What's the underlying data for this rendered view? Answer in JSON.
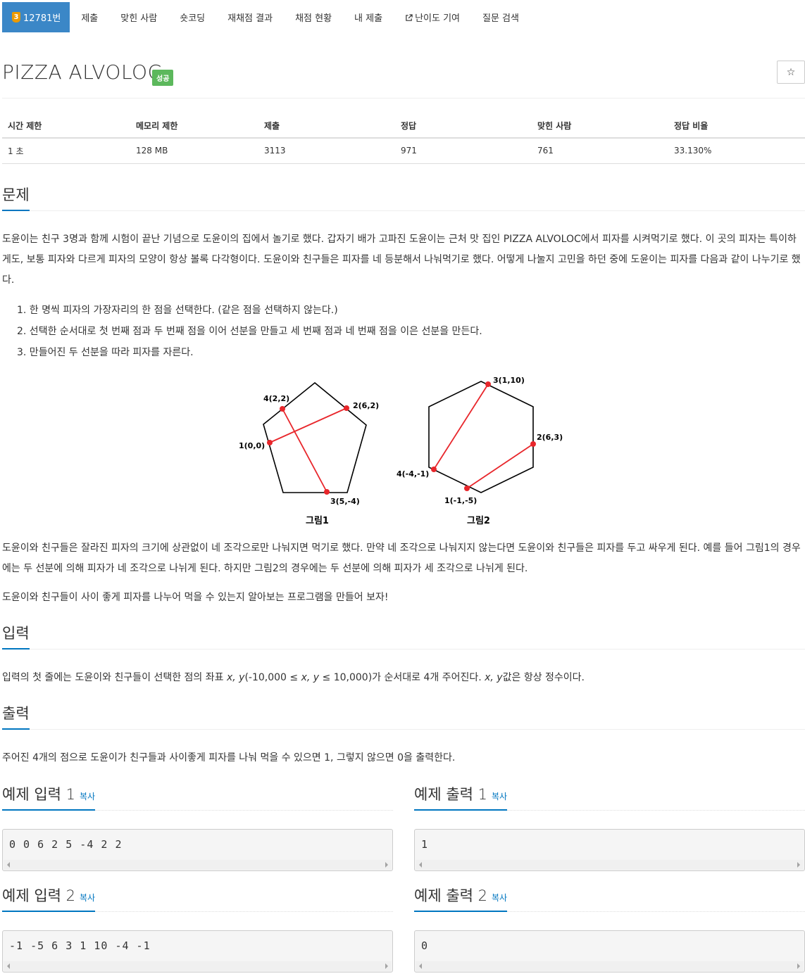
{
  "nav": {
    "problem_tier": "3",
    "problem_id": "12781번",
    "items": [
      "제출",
      "맞힌 사람",
      "숏코딩",
      "재채점 결과",
      "채점 현황",
      "내 제출",
      "난이도 기여",
      "질문 검색"
    ]
  },
  "title": "PIZZA ALVOLOC",
  "result_label": "성공",
  "star": "☆",
  "info": {
    "headers": [
      "시간 제한",
      "메모리 제한",
      "제출",
      "정답",
      "맞힌 사람",
      "정답 비율"
    ],
    "values": [
      "1 초",
      "128 MB",
      "3113",
      "971",
      "761",
      "33.130%"
    ]
  },
  "sections": {
    "problem": "문제",
    "input": "입력",
    "output": "출력"
  },
  "problem": {
    "p1": "도윤이는 친구 3명과 함께 시험이 끝난 기념으로 도윤이의 집에서 놀기로 했다. 갑자기 배가 고파진 도윤이는 근처 맛 집인 PIZZA ALVOLOC에서 피자를 시켜먹기로 했다. 이 곳의 피자는 특이하게도, 보통 피자와 다르게 피자의 모양이 항상 볼록 다각형이다. 도윤이와 친구들은 피자를 네 등분해서 나눠먹기로 했다. 어떻게 나눌지 고민을 하던 중에 도윤이는 피자를 다음과 같이 나누기로 했다.",
    "steps": [
      "1. 한 명씩 피자의 가장자리의 한 점을 선택한다. (같은 점을 선택하지 않는다.)",
      "2. 선택한 순서대로 첫 번째 점과 두 번째 점을 이어 선분을 만들고 세 번째 점과 네 번째 점을 이은 선분을 만든다.",
      "3. 만들어진 두 선분을 따라 피자를 자른다."
    ],
    "p2": "도윤이와 친구들은 잘라진 피자의 크기에 상관없이 네 조각으로만 나눠지면 먹기로 했다. 만약 네 조각으로 나눠지지 않는다면 도윤이와 친구들은 피자를 두고 싸우게 된다. 예를 들어 그림1의 경우에는 두 선분에 의해 피자가 네 조각으로 나뉘게 된다. 하지만 그림2의 경우에는 두 선분에 의해 피자가 세 조각으로 나뉘게 된다.",
    "p3": "도윤이와 친구들이 사이 좋게 피자를 나누어 먹을 수 있는지 알아보는 프로그램을 만들어 보자!"
  },
  "figure": {
    "fig1": {
      "caption": "그림1",
      "labels": [
        "1(0,0)",
        "2(6,2)",
        "3(5,-4)",
        "4(2,2)"
      ]
    },
    "fig2": {
      "caption": "그림2",
      "labels": [
        "1(-1,-5)",
        "2(6,3)",
        "3(1,10)",
        "4(-4,-1)"
      ]
    },
    "line_color": "#e8262b"
  },
  "input_text": {
    "a": "입력의 첫 줄에는 도윤이와 친구들이 선택한 점의 좌표 ",
    "xy": "x, y",
    "b": "(-10,000 ≤ ",
    "x2": "x, y",
    "c": " ≤ 10,000)가 순서대로 4개 주어진다. ",
    "xy2": "x, y",
    "d": "값은 항상 정수이다."
  },
  "output_text": "주어진 4개의 점으로 도윤이가 친구들과 사이좋게 피자를 나눠 먹을 수 있으면 1, 그렇지 않으면 0을 출력한다.",
  "samples": {
    "copy": "복사",
    "in1_title": "예제 입력 1",
    "out1_title": "예제 출력 1",
    "in2_title": "예제 입력 2",
    "out2_title": "예제 출력 2",
    "in1": "0 0 6 2 5 -4 2 2",
    "out1": "1",
    "in2": "-1 -5 6 3 1 10 -4 -1",
    "out2": "0"
  }
}
